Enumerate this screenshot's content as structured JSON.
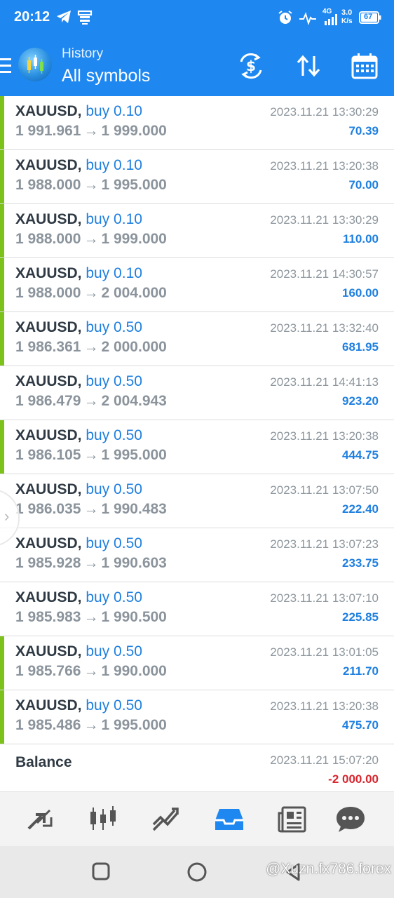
{
  "status_bar": {
    "time": "20:12",
    "speed_value": "3.0",
    "speed_unit": "K/s",
    "battery": "67",
    "network": "4G"
  },
  "app_bar": {
    "subtitle": "History",
    "title": "All symbols"
  },
  "trades": [
    {
      "symbol": "XAUUSD,",
      "direction": "buy 0.10",
      "open_price": "1 991.961",
      "close_price": "1 999.000",
      "datetime": "2023.11.21 13:30:29",
      "profit": "70.39",
      "marked": true
    },
    {
      "symbol": "XAUUSD,",
      "direction": "buy 0.10",
      "open_price": "1 988.000",
      "close_price": "1 995.000",
      "datetime": "2023.11.21 13:20:38",
      "profit": "70.00",
      "marked": true
    },
    {
      "symbol": "XAUUSD,",
      "direction": "buy 0.10",
      "open_price": "1 988.000",
      "close_price": "1 999.000",
      "datetime": "2023.11.21 13:30:29",
      "profit": "110.00",
      "marked": true
    },
    {
      "symbol": "XAUUSD,",
      "direction": "buy 0.10",
      "open_price": "1 988.000",
      "close_price": "2 004.000",
      "datetime": "2023.11.21 14:30:57",
      "profit": "160.00",
      "marked": true
    },
    {
      "symbol": "XAUUSD,",
      "direction": "buy 0.50",
      "open_price": "1 986.361",
      "close_price": "2 000.000",
      "datetime": "2023.11.21 13:32:40",
      "profit": "681.95",
      "marked": true
    },
    {
      "symbol": "XAUUSD,",
      "direction": "buy 0.50",
      "open_price": "1 986.479",
      "close_price": "2 004.943",
      "datetime": "2023.11.21 14:41:13",
      "profit": "923.20",
      "marked": false
    },
    {
      "symbol": "XAUUSD,",
      "direction": "buy 0.50",
      "open_price": "1 986.105",
      "close_price": "1 995.000",
      "datetime": "2023.11.21 13:20:38",
      "profit": "444.75",
      "marked": true
    },
    {
      "symbol": "XAUUSD,",
      "direction": "buy 0.50",
      "open_price": "1 986.035",
      "close_price": "1 990.483",
      "datetime": "2023.11.21 13:07:50",
      "profit": "222.40",
      "marked": false
    },
    {
      "symbol": "XAUUSD,",
      "direction": "buy 0.50",
      "open_price": "1 985.928",
      "close_price": "1 990.603",
      "datetime": "2023.11.21 13:07:23",
      "profit": "233.75",
      "marked": false
    },
    {
      "symbol": "XAUUSD,",
      "direction": "buy 0.50",
      "open_price": "1 985.983",
      "close_price": "1 990.500",
      "datetime": "2023.11.21 13:07:10",
      "profit": "225.85",
      "marked": false
    },
    {
      "symbol": "XAUUSD,",
      "direction": "buy 0.50",
      "open_price": "1 985.766",
      "close_price": "1 990.000",
      "datetime": "2023.11.21 13:01:05",
      "profit": "211.70",
      "marked": true
    },
    {
      "symbol": "XAUUSD,",
      "direction": "buy 0.50",
      "open_price": "1 985.486",
      "close_price": "1 995.000",
      "datetime": "2023.11.21 13:20:38",
      "profit": "475.70",
      "marked": true
    }
  ],
  "balance": {
    "label": "Balance",
    "datetime": "2023.11.21 15:07:20",
    "amount": "-2 000.00"
  },
  "arrow_glyph": "→",
  "bottom_nav": [
    "quotes-icon",
    "chart-icon",
    "trade-icon",
    "history-icon",
    "news-icon",
    "chat-icon"
  ],
  "watermark": "@Xuzn.fx786.forex",
  "colors": {
    "brand_blue": "#1e87f0",
    "buy_blue": "#1e7fe0",
    "marker_green": "#7cc21a",
    "loss_red": "#d8262f"
  }
}
